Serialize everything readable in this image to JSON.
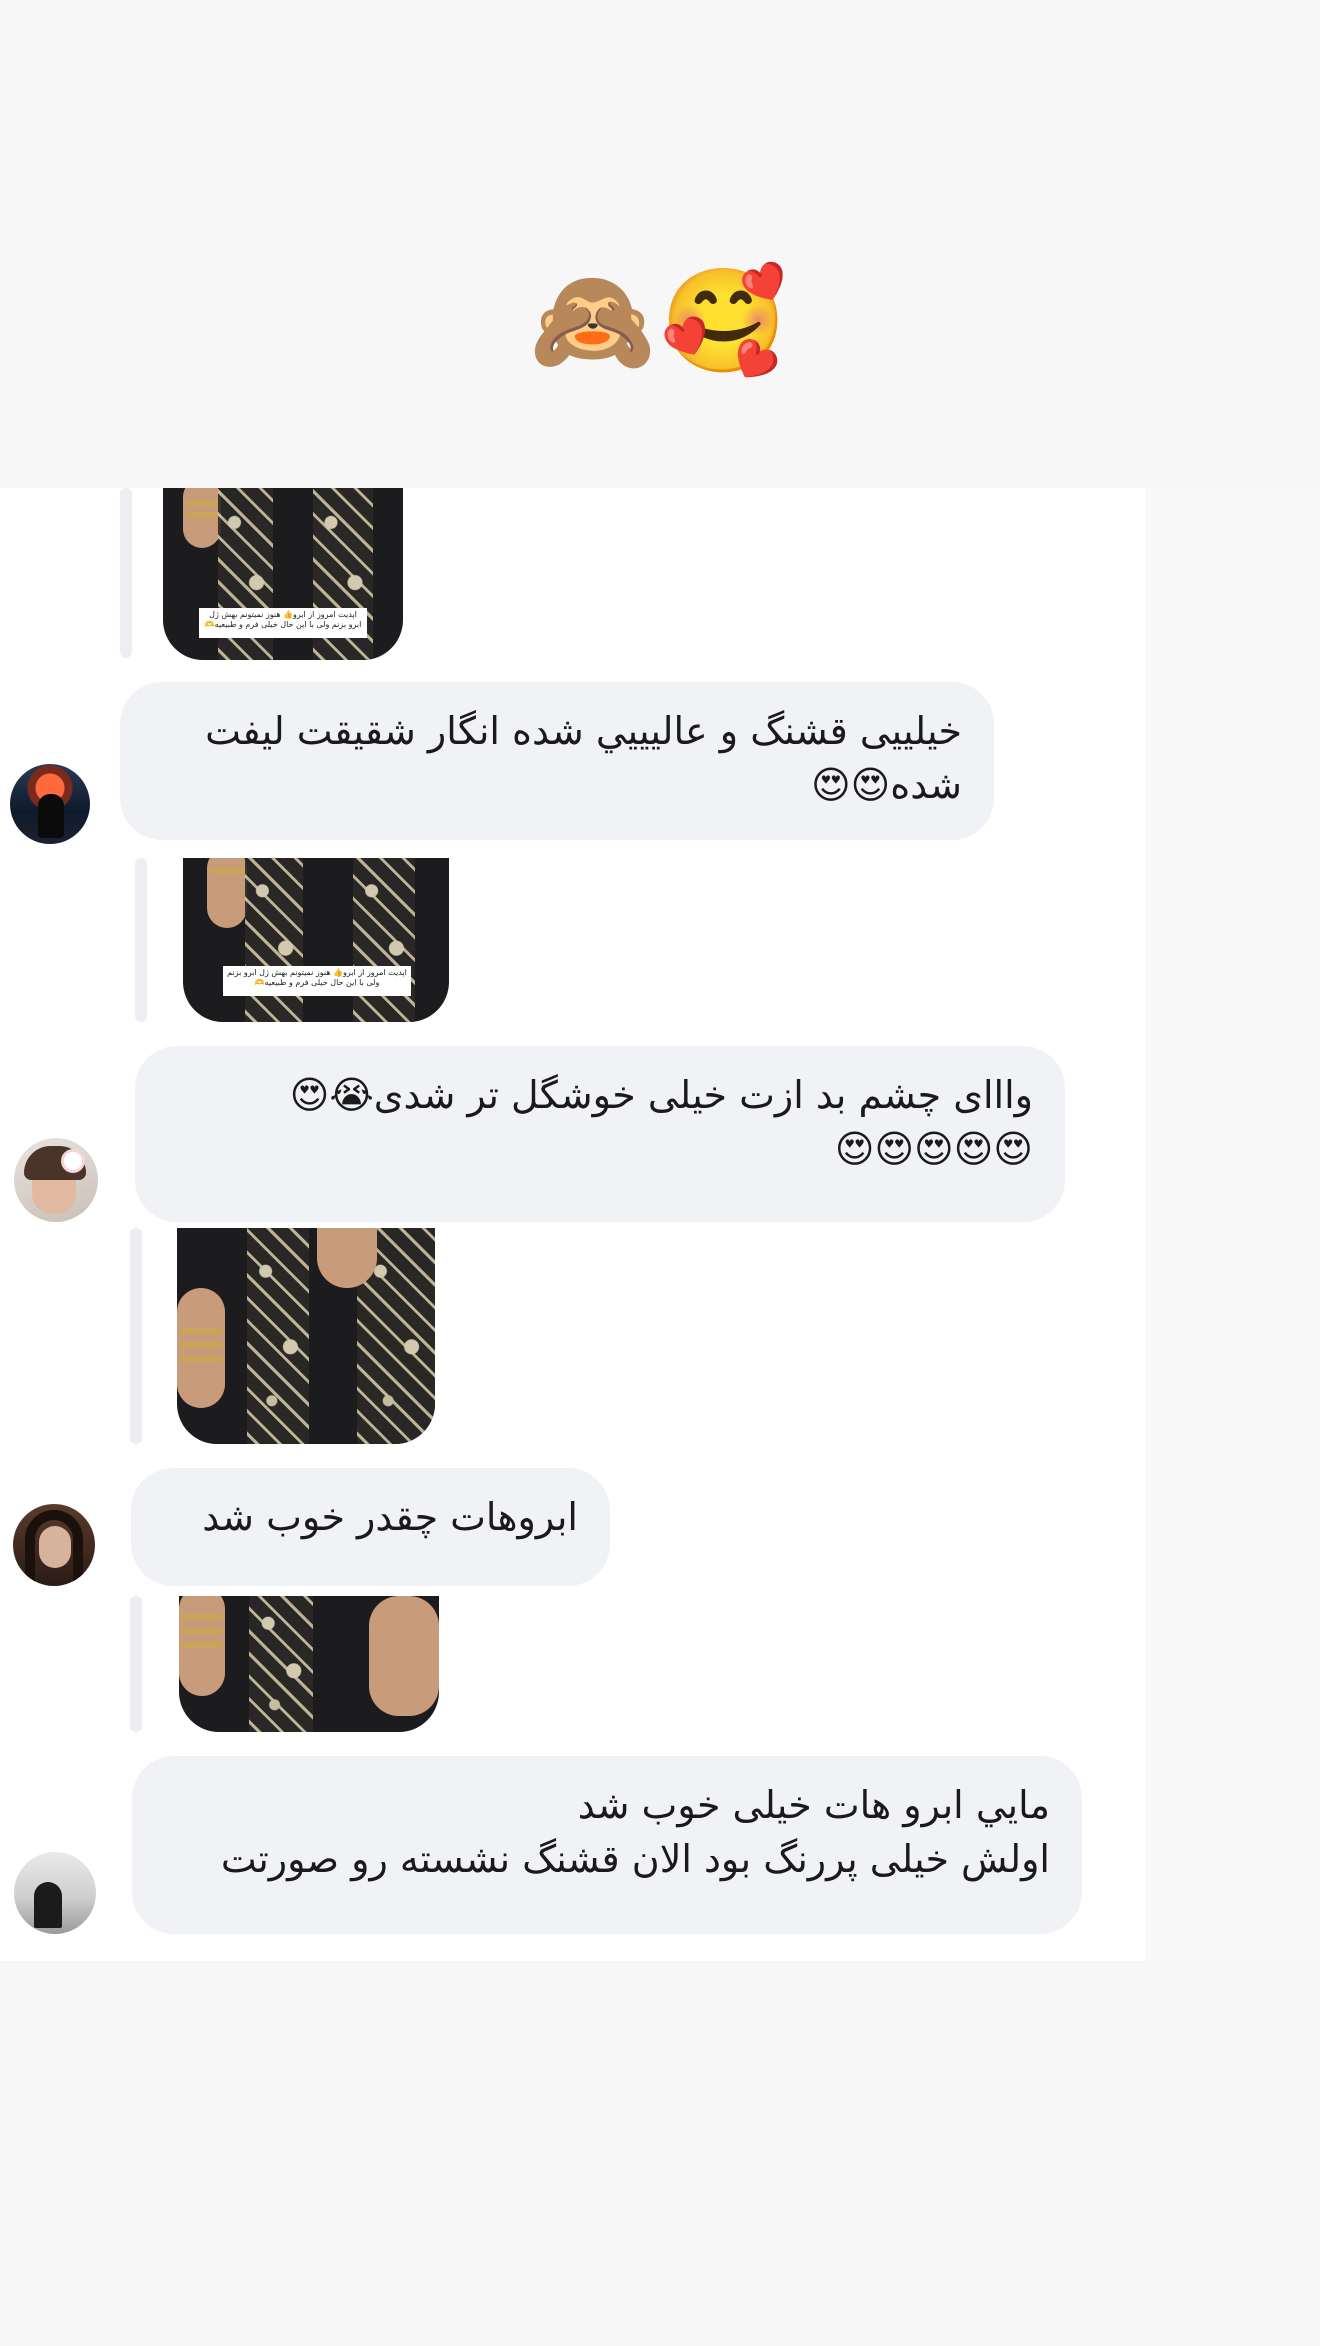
{
  "reaction_row": {
    "emojis": "🙈🥰"
  },
  "messages": [
    {
      "id": "m0",
      "reply_caption": "اپدیت امروز از ابرو👍 هنوز نمیتونم بهش ژل ابرو بزنم ولی با این حال خیلی فرم و طبیعیه🫶"
    },
    {
      "id": "m1",
      "text": "خیلییی قشنگ و عاليييي شده انگار شقيقت ليفت شده😍😍",
      "reply_caption": "اپدیت امروز از ابرو👍 هنوز نمیتونم بهش ژل ابرو بزنم ولی با این حال خیلی فرم و طبیعیه🫶"
    },
    {
      "id": "m2",
      "text": "وااای چشم بد ازت خیلی خوشگل تر شدی😭😍\n😍😍😍😍😍"
    },
    {
      "id": "m3",
      "text": "ابروهات چقدر خوب شد"
    },
    {
      "id": "m4",
      "text": "مايي ابرو هات خيلى خوب شد\nاولش خيلى پررنگ بود الان قشنگ نشسته رو صورتت"
    }
  ],
  "colors": {
    "bubble": "#f0f2f5",
    "panel": "#ffffff",
    "page_bg": "#f7f7f7"
  }
}
